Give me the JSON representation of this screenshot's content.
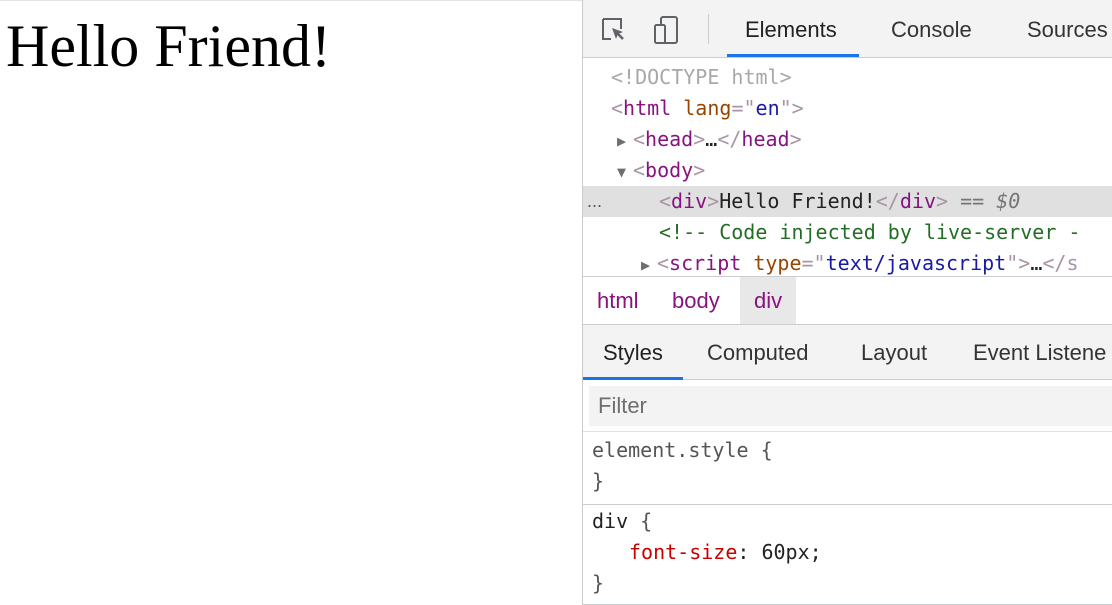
{
  "page": {
    "heading": "Hello Friend!"
  },
  "devtools": {
    "toolbar": {
      "inspect_icon": "inspect-element-icon",
      "device_icon": "device-toolbar-icon"
    },
    "tabs": [
      "Elements",
      "Console",
      "Sources"
    ],
    "active_tab": "Elements",
    "dom": {
      "doctype": "<!DOCTYPE html>",
      "html_open_tag": "html",
      "html_attr_name": "lang",
      "html_attr_value": "en",
      "head_tag": "head",
      "head_ellipsis": "…",
      "body_tag": "body",
      "div_tag": "div",
      "div_text": "Hello Friend!",
      "selected_marker": "== $0",
      "comment": "<!-- Code injected by live-server -",
      "script_tag": "script",
      "script_attr_name": "type",
      "script_attr_value": "text/javascript",
      "script_ellipsis": "…",
      "script_close_partial": "</s",
      "more_icon": "..."
    },
    "breadcrumbs": [
      "html",
      "body",
      "div"
    ],
    "style_tabs": [
      "Styles",
      "Computed",
      "Layout",
      "Event Listene"
    ],
    "active_style_tab": "Styles",
    "filter_placeholder": "Filter",
    "rules": [
      {
        "selector": "element.style",
        "open": "{",
        "close": "}",
        "declarations": []
      },
      {
        "selector": "div",
        "open": "{",
        "close": "}",
        "declarations": [
          {
            "property": "font-size",
            "value": "60px"
          }
        ]
      }
    ],
    "colors": {
      "accent": "#1a73e8",
      "tag": "#881280",
      "attr_name": "#994500",
      "attr_value": "#1a1aa6",
      "comment": "#236e25",
      "css_property": "#c80000"
    }
  }
}
